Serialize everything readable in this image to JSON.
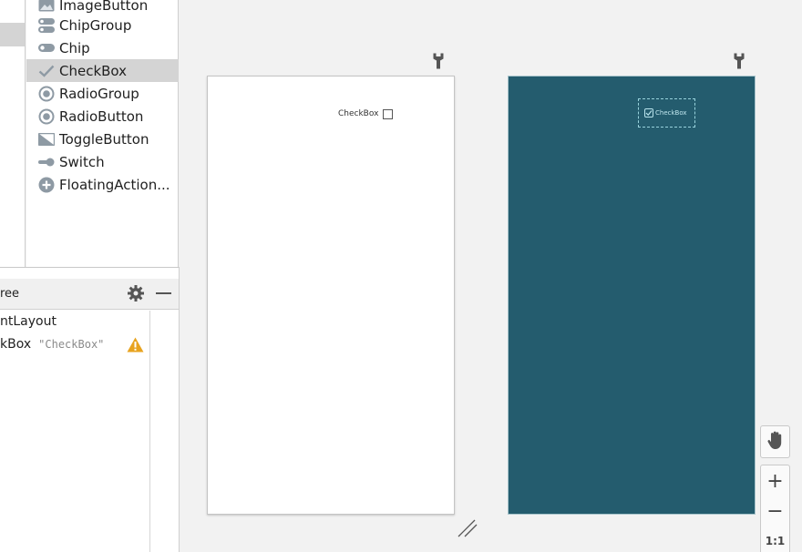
{
  "palette": {
    "items": [
      {
        "label": "ImageButton",
        "icon": "image-icon"
      },
      {
        "label": "ChipGroup",
        "icon": "chip-group-icon"
      },
      {
        "label": "Chip",
        "icon": "chip-icon"
      },
      {
        "label": "CheckBox",
        "icon": "checkmark-icon",
        "selected": true
      },
      {
        "label": "RadioGroup",
        "icon": "radio-group-icon"
      },
      {
        "label": "RadioButton",
        "icon": "radio-button-icon"
      },
      {
        "label": "ToggleButton",
        "icon": "toggle-button-icon"
      },
      {
        "label": "Switch",
        "icon": "switch-icon"
      },
      {
        "label": "FloatingAction...",
        "icon": "plus-circle-icon"
      }
    ]
  },
  "component_tree": {
    "title": "ree",
    "rows": [
      {
        "label": "ntLayout"
      },
      {
        "label": "kBox",
        "attr": "\"CheckBox\"",
        "warning": true
      }
    ]
  },
  "design": {
    "checkbox_label": "CheckBox"
  },
  "blueprint": {
    "checkbox_label": "CheckBox",
    "background_color": "#245c6e"
  },
  "zoom": {
    "zoom_in": "+",
    "zoom_out": "−",
    "ratio": "1:1"
  }
}
